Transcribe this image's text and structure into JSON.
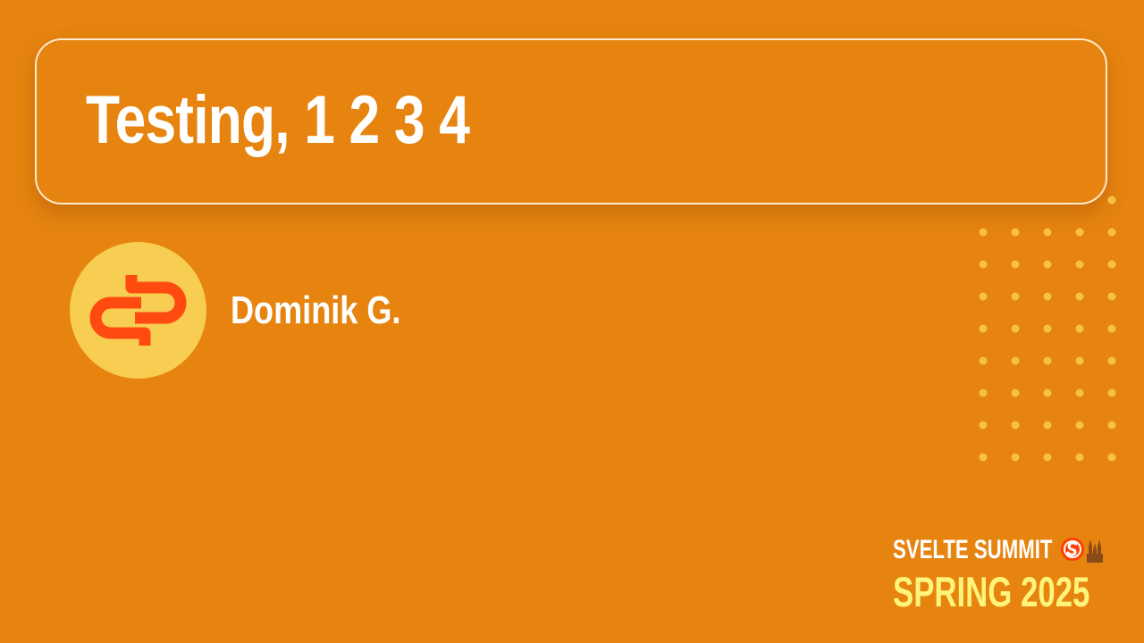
{
  "slide": {
    "title": "Testing, 1 2 3 4",
    "speaker_name": "Dominik G."
  },
  "branding": {
    "event_name": "SVELTE SUMMIT",
    "edition": "SPRING 2025"
  },
  "icons": {
    "avatar": "chain-link-logo-icon",
    "event_logo": "svelte-logo-icon",
    "event_accent": "cathedral-icon"
  },
  "colors": {
    "background": "#e6840f",
    "card_border": "#ffeed6",
    "title_text": "#ffffff",
    "avatar_bg": "#f7cd52",
    "avatar_logo": "#ff4b0f",
    "dots": "#f6c044",
    "edition_text": "#fff47a"
  }
}
